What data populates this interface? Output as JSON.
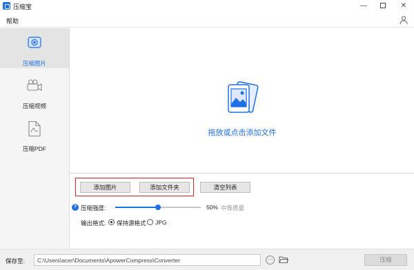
{
  "window": {
    "title": "压缩宝",
    "minimize_glyph": "—",
    "close_glyph": "✕"
  },
  "menu": {
    "help": "帮助"
  },
  "sidebar": {
    "items": [
      {
        "label": "压缩图片",
        "icon": "image-compress-icon",
        "active": true
      },
      {
        "label": "压缩视频",
        "icon": "video-icon",
        "active": false
      },
      {
        "label": "压缩PDF",
        "icon": "pdf-icon",
        "active": false
      }
    ]
  },
  "dropzone": {
    "text": "拖放或点击添加文件"
  },
  "actions": {
    "add_image": "添加图片",
    "add_folder": "添加文件夹",
    "clear_list": "清空列表"
  },
  "compression": {
    "help_glyph": "?",
    "strength_label": "压缩强度:",
    "strength_value": "50%",
    "strength_fraction": 0.5,
    "quality_text": "中等质量"
  },
  "output": {
    "format_label": "输出格式:",
    "options": [
      {
        "label": "保持源格式",
        "selected": true
      },
      {
        "label": "JPG",
        "selected": false
      }
    ]
  },
  "footer": {
    "save_label": "保存至:",
    "path": "C:\\Users\\acer\\Documents\\ApowerCompress\\Converter",
    "more_glyph": "···",
    "compress_button": "压缩"
  },
  "colors": {
    "accent": "#1f6fe5",
    "highlight": "#e0201b"
  }
}
